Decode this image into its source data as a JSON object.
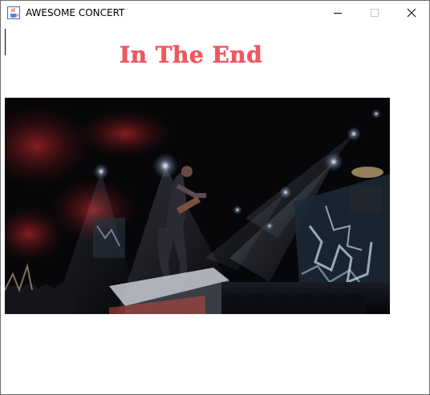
{
  "window": {
    "title": "AWESOME CONCERT",
    "icon": "java-cup-icon",
    "controls": [
      "minimize-icon",
      "maximize-icon",
      "close-icon"
    ]
  },
  "main": {
    "song_title": "In The End",
    "song_title_color": "#f0575f",
    "image": "concert-stage-photo"
  }
}
